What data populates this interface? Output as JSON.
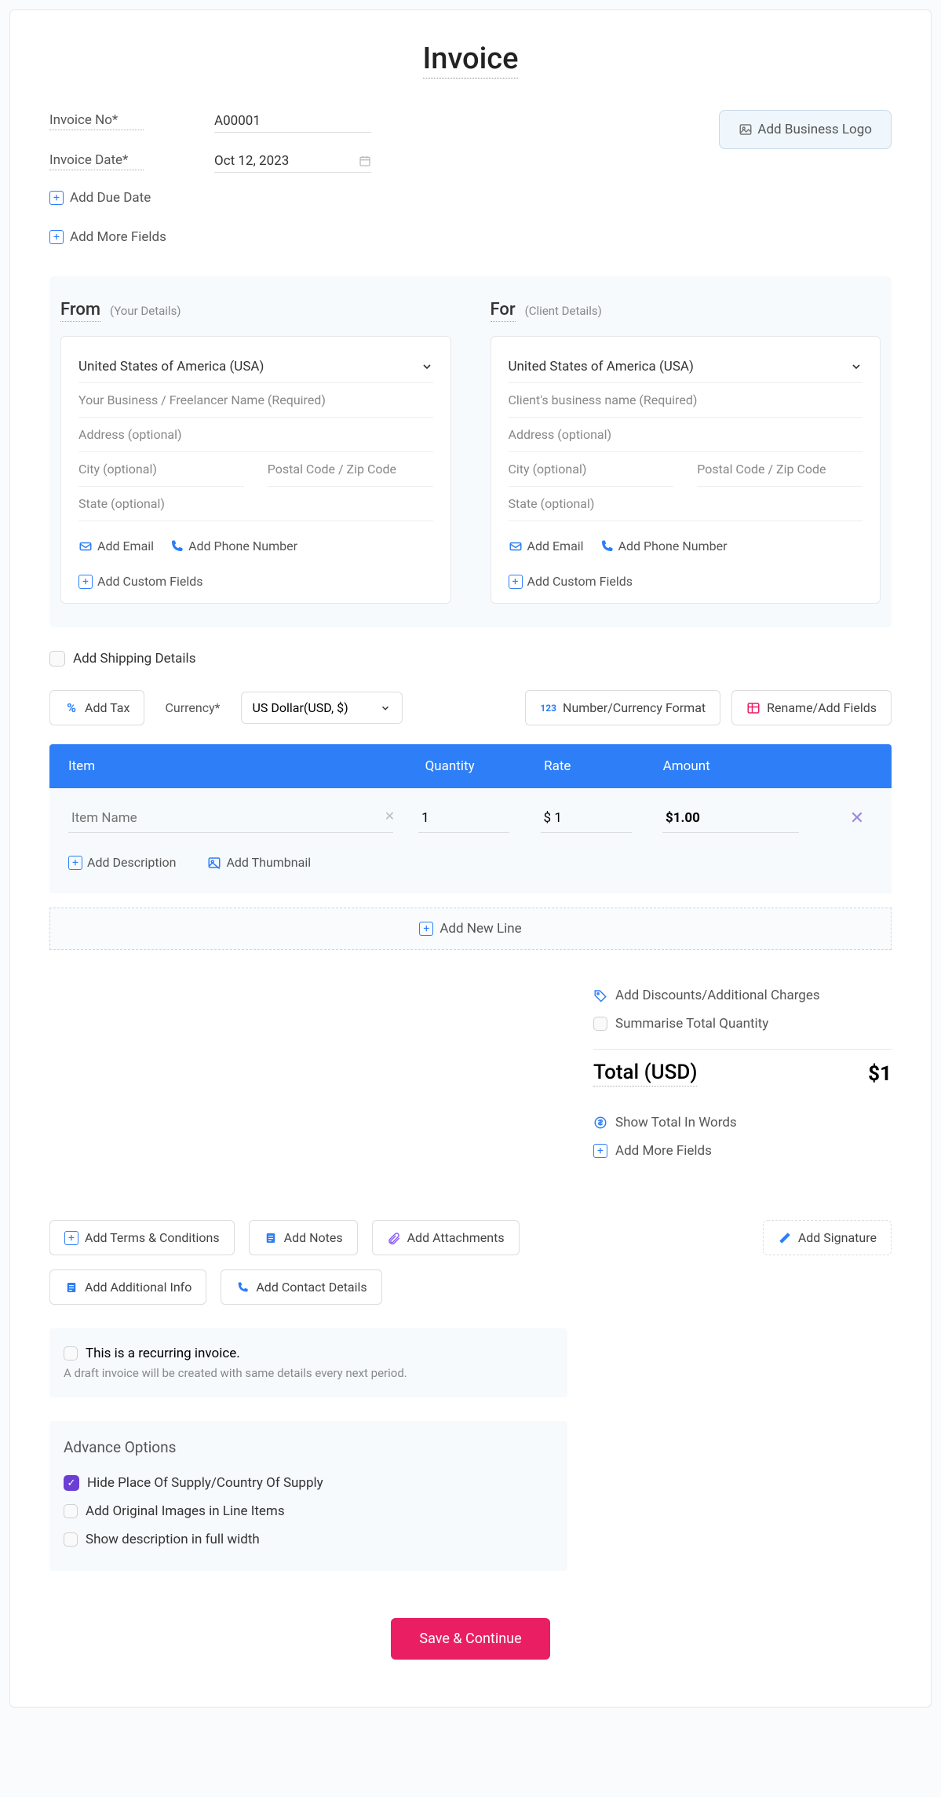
{
  "title": "Invoice",
  "header": {
    "invoice_no_label": "Invoice No*",
    "invoice_no_value": "A00001",
    "invoice_date_label": "Invoice Date*",
    "invoice_date_value": "Oct 12, 2023",
    "add_due_date": "Add Due Date",
    "add_more_fields": "Add More Fields",
    "add_logo": "Add Business Logo"
  },
  "from": {
    "heading": "From",
    "sub": "(Your Details)",
    "country": "United States of America (USA)",
    "name_ph": "Your Business / Freelancer Name (Required)",
    "address_ph": "Address (optional)",
    "city_ph": "City (optional)",
    "postal_ph": "Postal Code / Zip Code",
    "state_ph": "State (optional)",
    "add_email": "Add Email",
    "add_phone": "Add Phone Number",
    "add_custom": "Add Custom Fields"
  },
  "for": {
    "heading": "For",
    "sub": "(Client Details)",
    "country": "United States of America (USA)",
    "name_ph": "Client's business name (Required)",
    "address_ph": "Address (optional)",
    "city_ph": "City (optional)",
    "postal_ph": "Postal Code / Zip Code",
    "state_ph": "State (optional)",
    "add_email": "Add Email",
    "add_phone": "Add Phone Number",
    "add_custom": "Add Custom Fields"
  },
  "shipping": {
    "label": "Add Shipping Details"
  },
  "toolbar": {
    "add_tax": "Add Tax",
    "currency_label": "Currency*",
    "currency_value": "US Dollar(USD, $)",
    "number_format": "Number/Currency Format",
    "rename_fields": "Rename/Add Fields"
  },
  "table": {
    "h_item": "Item",
    "h_qty": "Quantity",
    "h_rate": "Rate",
    "h_amount": "Amount",
    "row": {
      "name_ph": "Item Name",
      "qty": "1",
      "rate": "$ 1",
      "amount": "$1.00"
    },
    "add_desc": "Add Description",
    "add_thumb": "Add Thumbnail",
    "add_line": "Add New Line"
  },
  "totals": {
    "discounts": "Add Discounts/Additional Charges",
    "summarise": "Summarise Total Quantity",
    "total_label": "Total (USD)",
    "total_value": "$1",
    "show_words": "Show Total In Words",
    "add_more": "Add More Fields"
  },
  "extras": {
    "terms": "Add Terms & Conditions",
    "notes": "Add Notes",
    "attach": "Add Attachments",
    "addl_info": "Add Additional Info",
    "contact": "Add Contact Details",
    "signature": "Add Signature"
  },
  "recurring": {
    "label": "This is a recurring invoice.",
    "sub": "A draft invoice will be created with same details every next period."
  },
  "advance": {
    "title": "Advance Options",
    "opt1": "Hide Place Of Supply/Country Of Supply",
    "opt2": "Add Original Images in Line Items",
    "opt3": "Show description in full width"
  },
  "save": "Save & Continue"
}
